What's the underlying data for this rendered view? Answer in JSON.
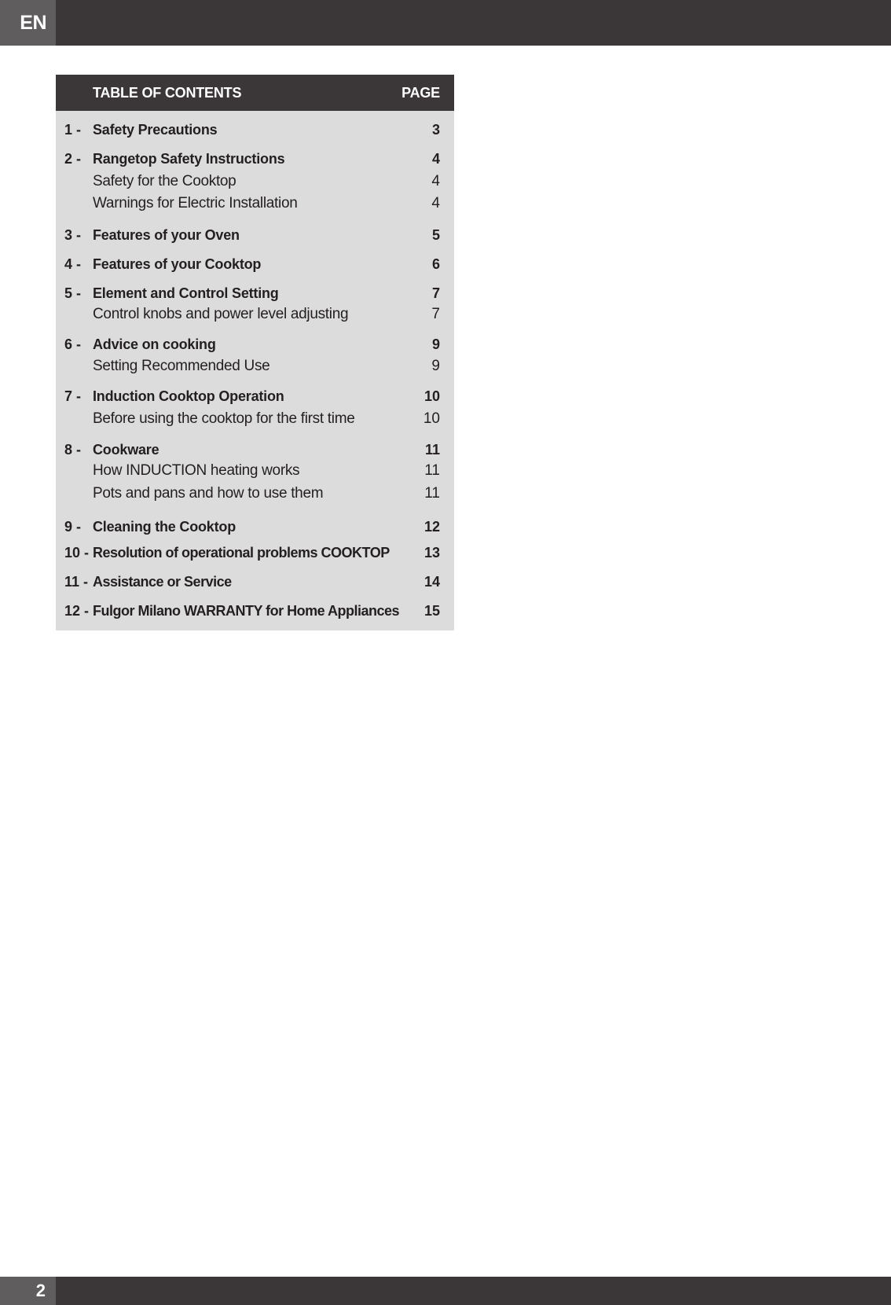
{
  "header": {
    "language": "EN"
  },
  "footer": {
    "page_number": "2"
  },
  "toc": {
    "title": "TABLE OF CONTENTS",
    "page_label": "PAGE",
    "entries": [
      {
        "type": "major",
        "number": "1 -",
        "title": "Safety Precautions",
        "page": "3"
      },
      {
        "type": "major",
        "number": "2 -",
        "title": "Rangetop Safety Instructions",
        "page": "4"
      },
      {
        "type": "sub",
        "number": "",
        "title": "Safety for the Cooktop",
        "page": "4"
      },
      {
        "type": "sub",
        "number": "",
        "title": "Warnings for Electric Installation",
        "page": "4"
      },
      {
        "type": "major",
        "number": "3 -",
        "title": "Features of your Oven",
        "page": "5"
      },
      {
        "type": "major",
        "number": "4 -",
        "title": "Features of your Cooktop",
        "page": "6"
      },
      {
        "type": "major",
        "number": "5 -",
        "title": "Element and Control Setting",
        "page": "7"
      },
      {
        "type": "sub",
        "number": "",
        "title": "Control knobs and power level adjusting",
        "page": "7"
      },
      {
        "type": "major",
        "number": "6 -",
        "title": "Advice on cooking",
        "page": "9"
      },
      {
        "type": "sub",
        "number": "",
        "title": "Setting Recommended Use",
        "page": "9"
      },
      {
        "type": "major",
        "number": "7 -",
        "title": "Induction Cooktop Operation",
        "page": "10"
      },
      {
        "type": "sub",
        "number": "",
        "title": "Before using the cooktop for the first time",
        "page": "10"
      },
      {
        "type": "major",
        "number": "8 -",
        "title": "Cookware",
        "page": "11"
      },
      {
        "type": "sub",
        "number": "",
        "title": "How INDUCTION heating works",
        "page": "11"
      },
      {
        "type": "sub",
        "number": "",
        "title": "Pots and pans and how to use them",
        "page": "11"
      },
      {
        "type": "major",
        "number": "9 -",
        "title": "Cleaning the Cooktop",
        "page": "12"
      },
      {
        "type": "major",
        "number": "10 -",
        "title": "Resolution of operational problems COOKTOP",
        "page": "13"
      },
      {
        "type": "major",
        "number": "11 -",
        "title": "Assistance or Service",
        "page": "14"
      },
      {
        "type": "major",
        "number": "12 -",
        "title": "Fulgor Milano WARRANTY for Home Appliances",
        "page": "15"
      }
    ]
  }
}
